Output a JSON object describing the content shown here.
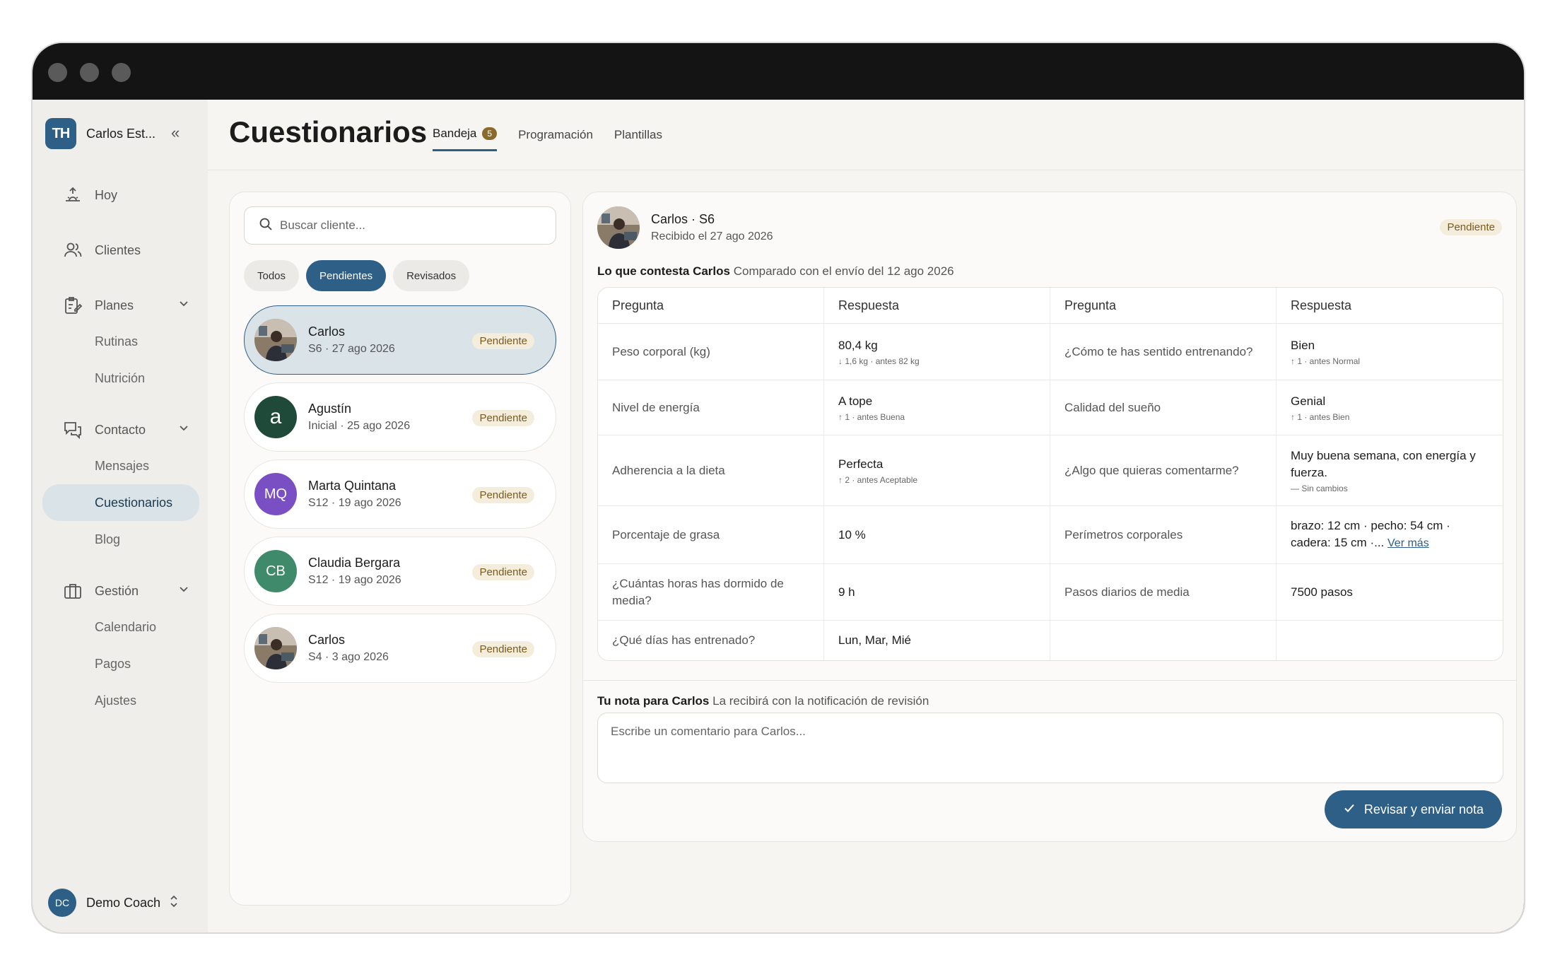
{
  "sidebar": {
    "brand_logo": "TH",
    "brand_name": "Carlos Est...",
    "items": [
      {
        "label": "Hoy",
        "icon": "sunrise-icon"
      },
      {
        "label": "Clientes",
        "icon": "users-icon"
      },
      {
        "label": "Planes",
        "icon": "clipboard-edit-icon",
        "sub": [
          "Rutinas",
          "Nutrición"
        ]
      },
      {
        "label": "Contacto",
        "icon": "chat-bubbles-icon",
        "sub": [
          "Mensajes",
          "Cuestionarios",
          "Blog"
        ]
      },
      {
        "label": "Gestión",
        "icon": "briefcase-icon",
        "sub": [
          "Calendario",
          "Pagos",
          "Ajustes"
        ]
      }
    ],
    "coach": {
      "initials": "DC",
      "name": "Demo Coach"
    }
  },
  "header": {
    "title": "Cuestionarios",
    "tabs": [
      {
        "label": "Bandeja",
        "count": "5"
      },
      {
        "label": "Programación"
      },
      {
        "label": "Plantillas"
      }
    ]
  },
  "list": {
    "search_placeholder": "Buscar cliente...",
    "filters": [
      "Todos",
      "Pendientes",
      "Revisados"
    ],
    "clients": [
      {
        "name": "Carlos",
        "meta": "S6 · 27 ago 2026",
        "status": "Pendiente",
        "avatar": "photo"
      },
      {
        "name": "Agustín",
        "meta": "Inicial · 25 ago 2026",
        "status": "Pendiente",
        "initials": "a",
        "color": "#1f4a3a"
      },
      {
        "name": "Marta Quintana",
        "meta": "S12 · 19 ago 2026",
        "status": "Pendiente",
        "initials": "MQ",
        "color": "#7b4fc4"
      },
      {
        "name": "Claudia Bergara",
        "meta": "S12 · 19 ago 2026",
        "status": "Pendiente",
        "initials": "CB",
        "color": "#3f8a6a"
      },
      {
        "name": "Carlos",
        "meta": "S4 · 3 ago 2026",
        "status": "Pendiente",
        "avatar": "photo"
      }
    ]
  },
  "detail": {
    "name": "Carlos · S6",
    "received": "Recibido el 27 ago 2026",
    "status": "Pendiente",
    "answers_title": "Lo que contesta Carlos",
    "answers_sub": "Comparado con el envío del 12 ago 2026",
    "col_question": "Pregunta",
    "col_answer": "Respuesta",
    "rows": [
      {
        "q1": "Peso corporal (kg)",
        "a1": "80,4 kg",
        "d1": "↓ 1,6 kg · antes 82 kg",
        "q2": "¿Cómo te has sentido entrenando?",
        "a2": "Bien",
        "d2": "↑ 1 · antes Normal"
      },
      {
        "q1": "Nivel de energía",
        "a1": "A tope",
        "d1": "↑ 1 · antes Buena",
        "q2": "Calidad del sueño",
        "a2": "Genial",
        "d2": "↑ 1 · antes Bien"
      },
      {
        "q1": "Adherencia a la dieta",
        "a1": "Perfecta",
        "d1": "↑ 2 · antes Aceptable",
        "q2": "¿Algo que quieras comentarme?",
        "a2": "Muy buena semana, con energía y fuerza.",
        "d2": "— Sin cambios"
      },
      {
        "q1": "Porcentaje de grasa",
        "a1": "10 %",
        "d1": "",
        "q2": "Perímetros corporales",
        "a2": "brazo: 12 cm · pecho: 54 cm · cadera: 15 cm ·...",
        "d2": "",
        "link": "Ver más"
      },
      {
        "q1": "¿Cuántas horas has dormido de media?",
        "a1": "9 h",
        "d1": "",
        "q2": "Pasos diarios de media",
        "a2": "7500 pasos",
        "d2": ""
      },
      {
        "q1": "¿Qué días has entrenado?",
        "a1": "Lun, Mar, Mié",
        "d1": "",
        "q2": "",
        "a2": "",
        "d2": ""
      }
    ],
    "note_title": "Tu nota para Carlos",
    "note_sub": "La recibirá con la notificación de revisión",
    "note_placeholder": "Escribe un comentario para Carlos...",
    "send_label": "Revisar y enviar nota"
  }
}
